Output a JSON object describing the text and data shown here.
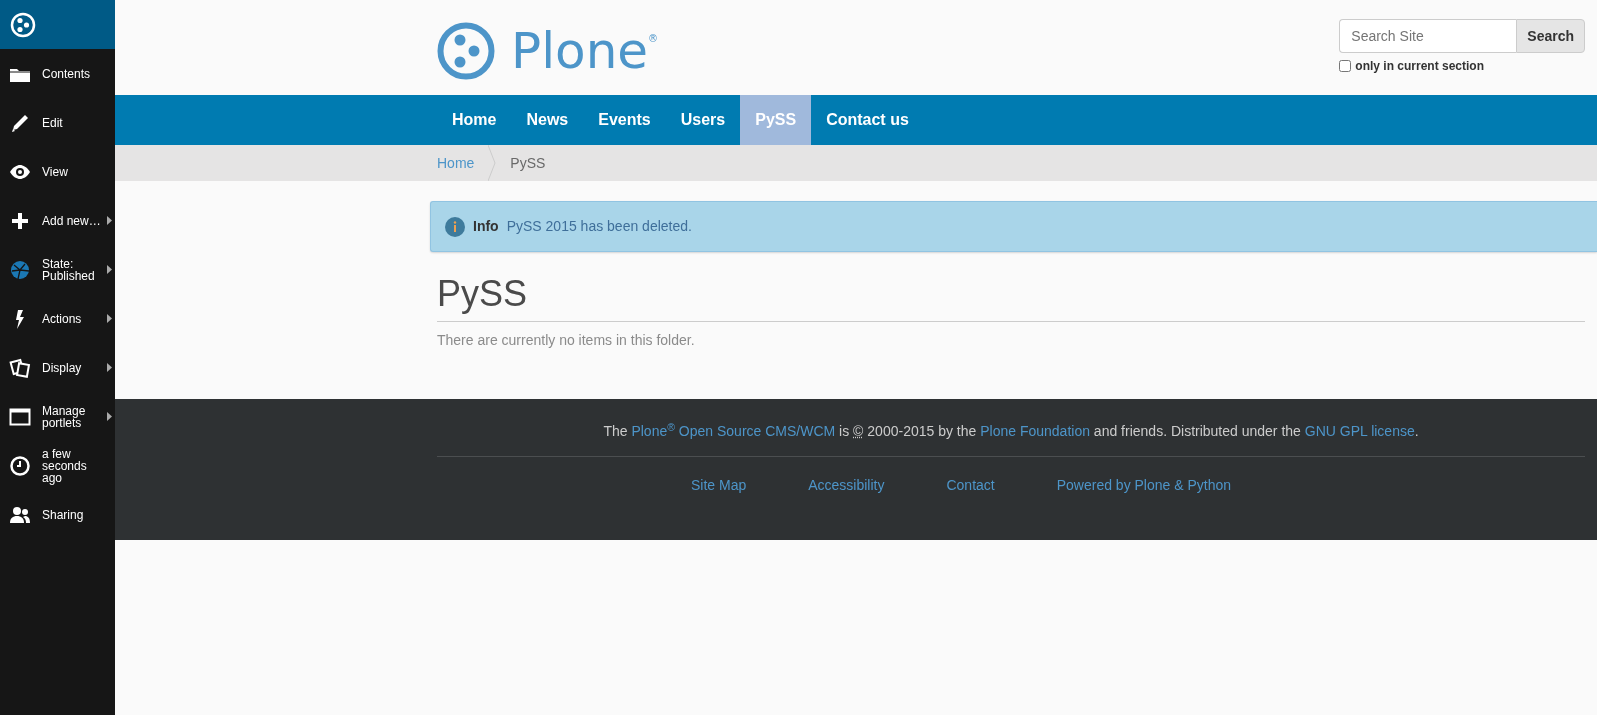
{
  "toolbar": {
    "items": [
      {
        "label": "Contents",
        "submenu": false
      },
      {
        "label": "Edit",
        "submenu": false
      },
      {
        "label": "View",
        "submenu": false
      },
      {
        "label": "Add new…",
        "submenu": true
      },
      {
        "label": "State: Published",
        "submenu": true
      },
      {
        "label": "Actions",
        "submenu": true
      },
      {
        "label": "Display",
        "submenu": true
      },
      {
        "label": "Manage portlets",
        "submenu": true
      },
      {
        "label": "a few seconds ago",
        "submenu": false
      },
      {
        "label": "Sharing",
        "submenu": false
      }
    ]
  },
  "logo": {
    "text": "Plone$^{®}$"
  },
  "search": {
    "placeholder": "Search Site",
    "button": "Search",
    "only_current_section": {
      "label": "only in current section",
      "checked": false
    }
  },
  "nav": [
    {
      "label": "Home",
      "selected": false
    },
    {
      "label": "News",
      "selected": false
    },
    {
      "label": "Events",
      "selected": false
    },
    {
      "label": "Users",
      "selected": false
    },
    {
      "label": "PySS",
      "selected": true
    },
    {
      "label": "Contact us",
      "selected": false
    }
  ],
  "breadcrumbs": [
    "Home",
    "PySS"
  ],
  "alert": {
    "title": "Info",
    "message": "PySS 2015 has been deleted."
  },
  "heading": "PySS",
  "empty_message": "There are currently no items in this folder.",
  "footer": {
    "notice": [
      {
        "kind": "text",
        "text": "The "
      },
      {
        "kind": "link",
        "text": "Plone$^{®}$ Open Source CMS/WCM"
      },
      {
        "kind": "text",
        "text": " is "
      },
      {
        "kind": "abbr",
        "text": "©"
      },
      {
        "kind": "text",
        "text": " 2000-2015 by the "
      },
      {
        "kind": "link",
        "text": "Plone Foundation"
      },
      {
        "kind": "text",
        "text": " and friends. Distributed under the "
      },
      {
        "kind": "link",
        "text": "GNU GPL license"
      },
      {
        "kind": "text",
        "text": "."
      }
    ],
    "links": [
      "Site Map",
      "Accessibility",
      "Contact",
      "Powered by Plone & Python"
    ]
  }
}
